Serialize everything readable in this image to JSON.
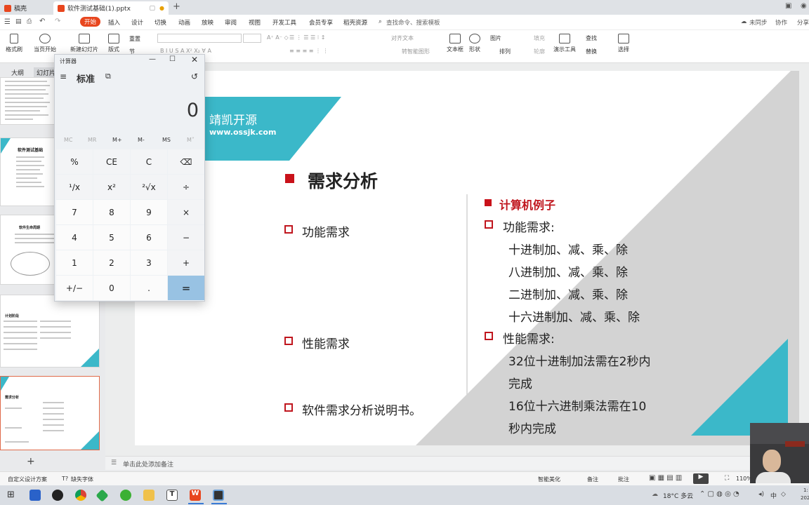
{
  "titlebar": {
    "tab1": "稿壳",
    "tab2": "软件测试基础(1).pptx"
  },
  "menu": {
    "file": "文件",
    "start": "开始",
    "insert": "插入",
    "design": "设计",
    "transition": "切换",
    "animation": "动画",
    "slideshow": "放映",
    "review": "审阅",
    "view": "视图",
    "developer": "开发工具",
    "member": "会员专享",
    "daoke": "稻壳资源",
    "search": "查找命令、搜索模板",
    "sync": "未同步",
    "collab": "协作",
    "share": "分享"
  },
  "ribbon": {
    "format_painter": "格式刷",
    "from_start": "当页开始",
    "new_slide": "新建幻灯片",
    "layout": "版式",
    "section": "节",
    "reset": "重置",
    "text_direction": "文字方向",
    "align_text": "对齐文本",
    "smartart": "转智能图形",
    "textbox": "文本框",
    "shape": "形状",
    "arrange": "排列",
    "picture": "图片",
    "outline": "轮廓",
    "fill": "填充",
    "presenter": "演示工具",
    "find": "查找",
    "replace": "替换",
    "select": "选择"
  },
  "leftpanel": {
    "outline_tab": "大纲",
    "slides_tab": "幻灯片",
    "add": "+",
    "thumb2_title": "软件测试基础",
    "thumb3_title": "软件生命周期",
    "thumb4_title": "计划阶段",
    "thumb5_title": "需求分析"
  },
  "slide": {
    "brand": "靖凯开源",
    "url": "www.ossjk.com",
    "title": "需求分析",
    "left_items": [
      "功能需求",
      "性能需求",
      "软件需求分析说明书。"
    ],
    "right_heading": "计算机例子",
    "func_label": "功能需求:",
    "func_lines": [
      "十进制加、减、乘、除",
      "八进制加、减、乘、除",
      "二进制加、减、乘、除",
      "十六进制加、减、乘、除"
    ],
    "perf_label": "性能需求:",
    "perf_lines": [
      "32位十进制加法需在2秒内",
      "完成",
      "16位十六进制乘法需在10",
      "秒内完成"
    ]
  },
  "calculator": {
    "title": "计算器",
    "mode": "标准",
    "display": "0",
    "memory": [
      "MC",
      "MR",
      "M+",
      "M-",
      "MS",
      "M˅"
    ],
    "keys": [
      [
        "%",
        "CE",
        "C",
        "⌫"
      ],
      [
        "¹∕x",
        "x²",
        "²√x",
        "÷"
      ],
      [
        "7",
        "8",
        "9",
        "×"
      ],
      [
        "4",
        "5",
        "6",
        "−"
      ],
      [
        "1",
        "2",
        "3",
        "+"
      ],
      [
        "+∕−",
        "0",
        ".",
        "="
      ]
    ]
  },
  "notes": {
    "placeholder": "单击此处添加备注"
  },
  "status": {
    "design_scheme": "自定义设计方案",
    "missing_font": "缺失字体",
    "smart_beautify": "智能美化",
    "notes": "备注",
    "comments": "批注",
    "zoom": "110%"
  },
  "taskbar": {
    "weather": "18°C 多云",
    "ime": "中",
    "time": "1:",
    "date": "202"
  },
  "colors": {
    "accent_teal": "#3bb8c9",
    "accent_red": "#c0161e",
    "wps_orange": "#e8461e",
    "calc_equals": "#98c2e3"
  }
}
